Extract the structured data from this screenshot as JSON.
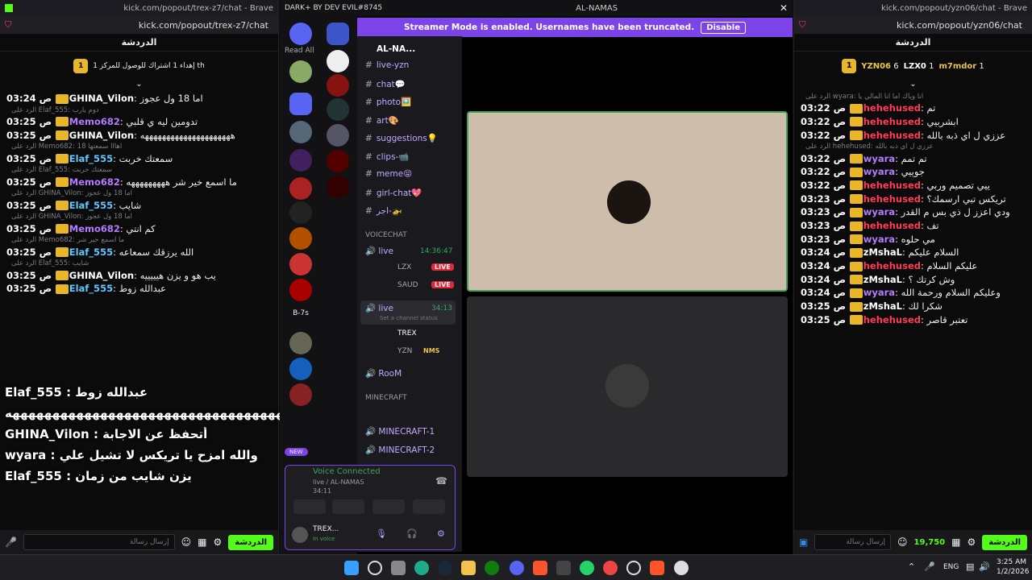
{
  "left": {
    "tab_title": "kick.com/popout/trex-z7/chat - Brave",
    "url": "kick.com/popout/trex-z7/chat",
    "chat_title": "الدردشة",
    "pin_text": "إهداء 1 اشتراك للوصول للمركز 1 th",
    "pin_rank": "1",
    "messages": [
      {
        "reply": "",
        "time": "03:24 ص",
        "name": "GHINA_Vilon",
        "cls": "nm-w",
        "text": "اما 18 ول عجوز"
      },
      {
        "reply": "الرد على Elaf_555: دوم يارب",
        "time": "03:25 ص",
        "name": "Memo682",
        "cls": "nm-p",
        "text": "تدومين ليه ي قلبي"
      },
      {
        "reply": "",
        "time": "03:25 ص",
        "name": "GHINA_Vilon",
        "cls": "nm-w",
        "text": "هههههههههههههههههههههه"
      },
      {
        "reply": "الرد على Memo682: اهااا سمعتها 18",
        "time": "03:25 ص",
        "name": "Elaf_555",
        "cls": "nm-b",
        "text": "سمعتك خربت"
      },
      {
        "reply": "الرد على Elaf_555: سمعتك خربت",
        "time": "03:25 ص",
        "name": "Memo682",
        "cls": "nm-p",
        "text": "ما اسمع خير شر هههههههههه"
      },
      {
        "reply": "الرد على GHINA_Vilon: اما 18 ول عجوز",
        "time": "03:25 ص",
        "name": "Elaf_555",
        "cls": "nm-b",
        "text": "شايب"
      },
      {
        "reply": "الرد على GHINA_Vilon: اما 18 ول عجوز",
        "time": "03:25 ص",
        "name": "Memo682",
        "cls": "nm-p",
        "text": "كم انتي"
      },
      {
        "reply": "الرد على Memo682: ما اسمع خير شر",
        "time": "03:25 ص",
        "name": "Elaf_555",
        "cls": "nm-b",
        "text": "الله يرزقك سمعاعه"
      },
      {
        "reply": "الرد على Elaf_555: شايب",
        "time": "03:25 ص",
        "name": "GHINA_Vilon",
        "cls": "nm-w",
        "text": "يب هو و يزن هيييييه"
      },
      {
        "reply": "",
        "time": "03:25 ص",
        "name": "Elaf_555",
        "cls": "nm-b",
        "text": "عبدالله زوط"
      }
    ],
    "overlay": [
      "عبدالله زوط : Elaf_555",
      "هههههههههههههههههههههههههههههههههههه",
      "أتحفظ عن الاجابة : GHINA_Vilon",
      "والله امزح يا تريكس لا تشيل علي : wyara",
      "يزن شايب من زمان : Elaf_555"
    ],
    "send_label": "الدردشة",
    "input_placeholder": "إرسال رسالة"
  },
  "discord": {
    "title": "AL-NAMAS",
    "brand": "DARK+ BY DEV EVIL#8745",
    "read_all": "Read All",
    "banner": "Streamer Mode is enabled. Usernames have been truncated.",
    "disable": "Disable",
    "server_name": "AL-NA...",
    "channels": [
      "live-yzn",
      "chat💬",
      "photo🖼️",
      "art🎨",
      "suggestions💡",
      "clips-📹",
      "meme😝",
      "girl-chat💖",
      "اجر-🚁"
    ],
    "voice_header": "VOICECHAT",
    "voice1": {
      "name": "live",
      "time": "14:36:47",
      "users": [
        "LZX",
        "SAUD"
      ],
      "live": "LIVE"
    },
    "voice2": {
      "name": "live",
      "time": "34:13",
      "status": "Set a channel status",
      "users": [
        "TREX",
        "YZN"
      ],
      "nms": "NMS"
    },
    "room": "RooM",
    "mc_header": "MINECRAFT",
    "mc": [
      "MINECRAFT-1",
      "MINECRAFT-2"
    ],
    "new_badge": "NEW",
    "b7s": "B-7s",
    "vc_connected": "Voice Connected",
    "vc_channel": "live / AL-NAMAS",
    "vc_time": "34:11",
    "user": "TREX...",
    "user_status": "In voice"
  },
  "right": {
    "tab_title": "kick.com/popout/yzn06/chat - Brave",
    "url": "kick.com/popout/yzn06/chat",
    "chat_title": "الدردشة",
    "top": [
      {
        "name": "YZN06",
        "count": "6"
      },
      {
        "name": "LZX0",
        "count": "1"
      },
      {
        "name": "m7mdor",
        "count": "1"
      }
    ],
    "top_rank": "1",
    "messages": [
      {
        "reply": "الرد على wyara: انا وياك اما انا المالي يا",
        "time": "03:22 ص",
        "name": "hehehused",
        "cls": "nm-r",
        "text": "تم"
      },
      {
        "reply": "",
        "time": "03:22 ص",
        "name": "hehehused",
        "cls": "nm-r",
        "text": "ابشربيي"
      },
      {
        "reply": "",
        "time": "03:22 ص",
        "name": "hehehused",
        "cls": "nm-r",
        "text": "عززي ل اي ذبه بالله"
      },
      {
        "reply": "الرد على hehehused: عززي ل اي ذبه بالله",
        "time": "03:22 ص",
        "name": "wyara",
        "cls": "nm-p",
        "text": "تم تمم"
      },
      {
        "reply": "",
        "time": "03:22 ص",
        "name": "wyara",
        "cls": "nm-p",
        "text": "جوييي"
      },
      {
        "reply": "",
        "time": "03:22 ص",
        "name": "hehehused",
        "cls": "nm-r",
        "text": "ييي تصميم وربي"
      },
      {
        "reply": "",
        "time": "03:23 ص",
        "name": "hehehused",
        "cls": "nm-r",
        "text": "تريكس تبي ارسمك؟"
      },
      {
        "reply": "",
        "time": "03:23 ص",
        "name": "wyara",
        "cls": "nm-p",
        "text": "ودي اعزز ل ذي بس م القدر"
      },
      {
        "reply": "",
        "time": "03:23 ص",
        "name": "hehehused",
        "cls": "nm-r",
        "text": "تف"
      },
      {
        "reply": "",
        "time": "03:23 ص",
        "name": "wyara",
        "cls": "nm-p",
        "text": "مي حلوه"
      },
      {
        "reply": "",
        "time": "03:24 ص",
        "name": "zMshaL",
        "cls": "nm-w",
        "text": "السلام عليكم"
      },
      {
        "reply": "",
        "time": "03:24 ص",
        "name": "hehehused",
        "cls": "nm-r",
        "text": "عليكم السلام"
      },
      {
        "reply": "",
        "time": "03:24 ص",
        "name": "zMshaL",
        "cls": "nm-w",
        "text": "وش كرتك ؟"
      },
      {
        "reply": "",
        "time": "03:24 ص",
        "name": "wyara",
        "cls": "nm-p",
        "text": "وعليكم السلام ورحمة الله"
      },
      {
        "reply": "",
        "time": "03:25 ص",
        "name": "zMshaL",
        "cls": "nm-w",
        "text": "شكرا لك"
      },
      {
        "reply": "",
        "time": "03:25 ص",
        "name": "hehehused",
        "cls": "nm-r",
        "text": "تعتبر قاصر"
      }
    ],
    "points": "19,750",
    "send_label": "الدردشة",
    "input_placeholder": "إرسال رسالة"
  },
  "taskbar": {
    "lang": "ENG",
    "time": "3:25 AM",
    "date": "1/2/2026"
  }
}
